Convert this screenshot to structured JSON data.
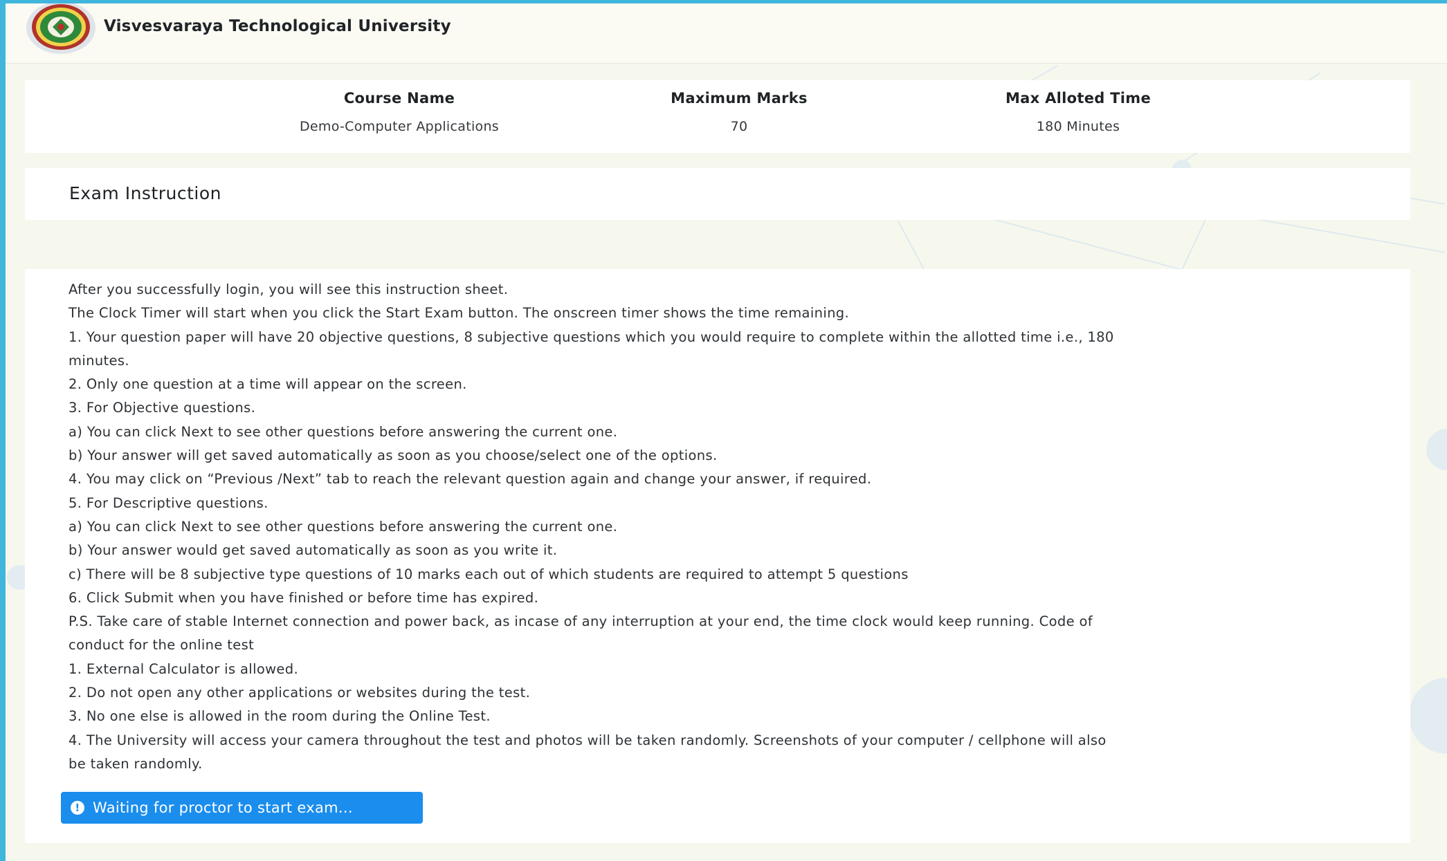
{
  "header": {
    "university_name": "Visvesvaraya Technological University",
    "logo_icon": "university-seal-logo"
  },
  "course_info": {
    "course_name_label": "Course Name",
    "course_name_value": "Demo-Computer Applications",
    "max_marks_label": "Maximum Marks",
    "max_marks_value": "70",
    "max_time_label": "Max Alloted Time",
    "max_time_value": "180 Minutes"
  },
  "instructions": {
    "title": "Exam Instruction",
    "lines": [
      "After you successfully login, you will see this instruction sheet.",
      "The Clock Timer will start when you click the Start Exam button. The onscreen timer shows the time remaining.",
      "1. Your question paper will have 20 objective questions, 8 subjective questions which you would require to complete within the allotted time i.e., 180",
      "minutes.",
      "2. Only one question at a time will appear on the screen.",
      "3. For Objective questions.",
      "a) You can click Next to see other questions before answering the current one.",
      "b) Your answer will get saved automatically as soon as you choose/select one of the options.",
      "4. You may click on “Previous /Next” tab to reach the relevant question again and change your answer, if required.",
      "5. For Descriptive questions.",
      "a) You can click Next to see other questions before answering the current one.",
      "b) Your answer would get saved automatically as soon as you write it.",
      "c) There will be 8 subjective type questions of 10 marks each out of which students are required to attempt 5 questions",
      "6. Click Submit when you have finished or before time has expired.",
      "P.S. Take care of stable Internet connection and power back, as incase of any interruption at your end, the time clock would keep running. Code of",
      "conduct for the online test",
      "1. External Calculator is allowed.",
      "2. Do not open any other applications or websites during the test.",
      "3. No one else is allowed in the room during the Online Test.",
      "4. The University will access your camera throughout the test and photos will be taken randomly. Screenshots of your computer / cellphone will also",
      "be taken randomly."
    ]
  },
  "status_button": {
    "label": "Waiting for proctor to start exam...",
    "icon": "exclamation-circle-icon"
  },
  "colors": {
    "accent_blue": "#1a8ded",
    "frame_blue": "#40b6dc"
  }
}
